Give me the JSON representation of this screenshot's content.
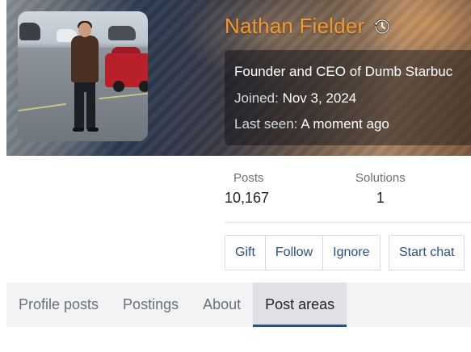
{
  "profile": {
    "name": "Nathan Fielder",
    "badge_icon": "history-clock-icon",
    "accent_color": "#f39a2e",
    "info": {
      "tagline": "Founder and CEO of Dumb Starbuc",
      "joined_label": "Joined:",
      "joined_value": "Nov 3, 2024",
      "last_seen_label": "Last seen:",
      "last_seen_value": "A moment ago"
    }
  },
  "stats": [
    {
      "label": "Posts",
      "value": "10,167"
    },
    {
      "label": "Solutions",
      "value": "1"
    }
  ],
  "actions": {
    "gift": "Gift",
    "follow": "Follow",
    "ignore": "Ignore",
    "start_chat": "Start chat"
  },
  "tabs": [
    {
      "label": "Profile posts",
      "active": false
    },
    {
      "label": "Postings",
      "active": false
    },
    {
      "label": "About",
      "active": false
    },
    {
      "label": "Post areas",
      "active": true
    }
  ],
  "colors": {
    "link": "#2b4f86",
    "tab_bar": "#f2f3f5",
    "tab_active": "#dfe1e4"
  }
}
